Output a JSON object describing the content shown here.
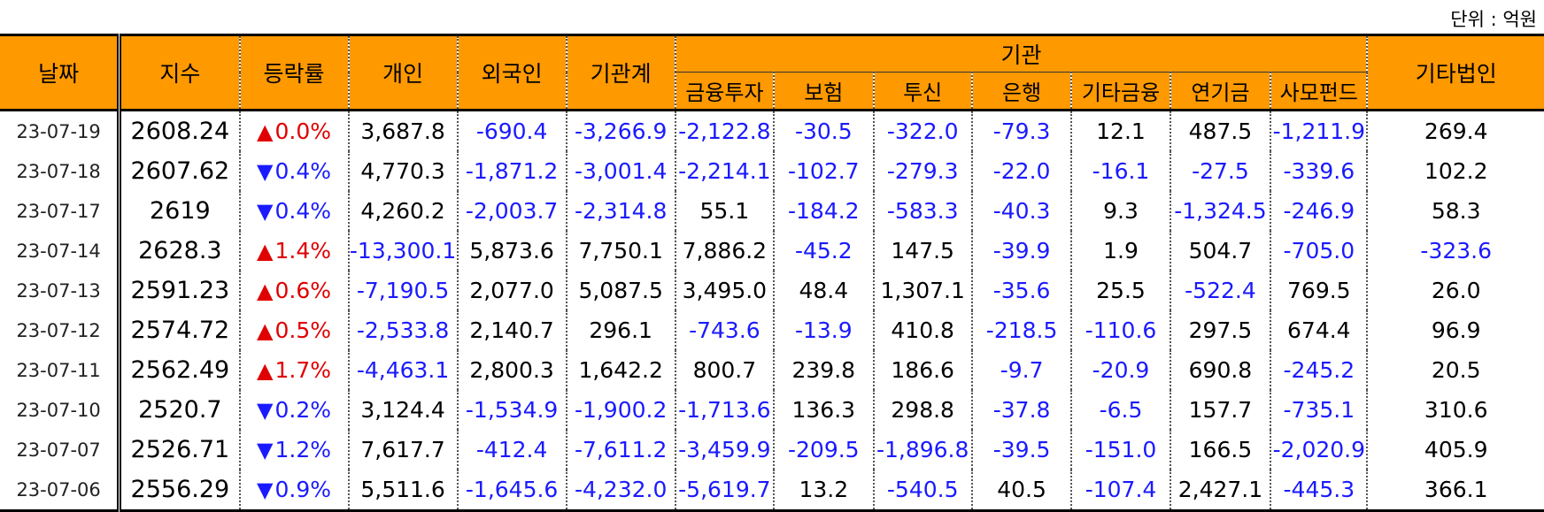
{
  "unit_label": "단위 : 억원",
  "header": {
    "date": "날짜",
    "index": "지수",
    "change": "등락률",
    "individual": "개인",
    "foreign": "외국인",
    "inst_total": "기관계",
    "institution": "기관",
    "sub": [
      "금융투자",
      "보험",
      "투신",
      "은행",
      "기타금융",
      "연기금",
      "사모펀드"
    ],
    "other_corp": "기타법인"
  },
  "colors": {
    "header_bg": "#FF9900",
    "negative": "#1a1aff",
    "up": "#e00000",
    "down": "#1a1aff"
  },
  "rows": [
    {
      "date": "23-07-19",
      "index": "2608.24",
      "dir": "up",
      "chg": "0.0%",
      "vals": [
        "3,687.8",
        "-690.4",
        "-3,266.9",
        "-2,122.8",
        "-30.5",
        "-322.0",
        "-79.3",
        "12.1",
        "487.5",
        "-1,211.9",
        "269.4"
      ]
    },
    {
      "date": "23-07-18",
      "index": "2607.62",
      "dir": "down",
      "chg": "0.4%",
      "vals": [
        "4,770.3",
        "-1,871.2",
        "-3,001.4",
        "-2,214.1",
        "-102.7",
        "-279.3",
        "-22.0",
        "-16.1",
        "-27.5",
        "-339.6",
        "102.2"
      ]
    },
    {
      "date": "23-07-17",
      "index": "2619",
      "dir": "down",
      "chg": "0.4%",
      "vals": [
        "4,260.2",
        "-2,003.7",
        "-2,314.8",
        "55.1",
        "-184.2",
        "-583.3",
        "-40.3",
        "9.3",
        "-1,324.5",
        "-246.9",
        "58.3"
      ]
    },
    {
      "date": "23-07-14",
      "index": "2628.3",
      "dir": "up",
      "chg": "1.4%",
      "vals": [
        "-13,300.1",
        "5,873.6",
        "7,750.1",
        "7,886.2",
        "-45.2",
        "147.5",
        "-39.9",
        "1.9",
        "504.7",
        "-705.0",
        "-323.6"
      ]
    },
    {
      "date": "23-07-13",
      "index": "2591.23",
      "dir": "up",
      "chg": "0.6%",
      "vals": [
        "-7,190.5",
        "2,077.0",
        "5,087.5",
        "3,495.0",
        "48.4",
        "1,307.1",
        "-35.6",
        "25.5",
        "-522.4",
        "769.5",
        "26.0"
      ]
    },
    {
      "date": "23-07-12",
      "index": "2574.72",
      "dir": "up",
      "chg": "0.5%",
      "vals": [
        "-2,533.8",
        "2,140.7",
        "296.1",
        "-743.6",
        "-13.9",
        "410.8",
        "-218.5",
        "-110.6",
        "297.5",
        "674.4",
        "96.9"
      ]
    },
    {
      "date": "23-07-11",
      "index": "2562.49",
      "dir": "up",
      "chg": "1.7%",
      "vals": [
        "-4,463.1",
        "2,800.3",
        "1,642.2",
        "800.7",
        "239.8",
        "186.6",
        "-9.7",
        "-20.9",
        "690.8",
        "-245.2",
        "20.5"
      ]
    },
    {
      "date": "23-07-10",
      "index": "2520.7",
      "dir": "down",
      "chg": "0.2%",
      "vals": [
        "3,124.4",
        "-1,534.9",
        "-1,900.2",
        "-1,713.6",
        "136.3",
        "298.8",
        "-37.8",
        "-6.5",
        "157.7",
        "-735.1",
        "310.6"
      ]
    },
    {
      "date": "23-07-07",
      "index": "2526.71",
      "dir": "down",
      "chg": "1.2%",
      "vals": [
        "7,617.7",
        "-412.4",
        "-7,611.2",
        "-3,459.9",
        "-209.5",
        "-1,896.8",
        "-39.5",
        "-151.0",
        "166.5",
        "-2,020.9",
        "405.9"
      ]
    },
    {
      "date": "23-07-06",
      "index": "2556.29",
      "dir": "down",
      "chg": "0.9%",
      "vals": [
        "5,511.6",
        "-1,645.6",
        "-4,232.0",
        "-5,619.7",
        "13.2",
        "-540.5",
        "40.5",
        "-107.4",
        "2,427.1",
        "-445.3",
        "366.1"
      ]
    }
  ]
}
